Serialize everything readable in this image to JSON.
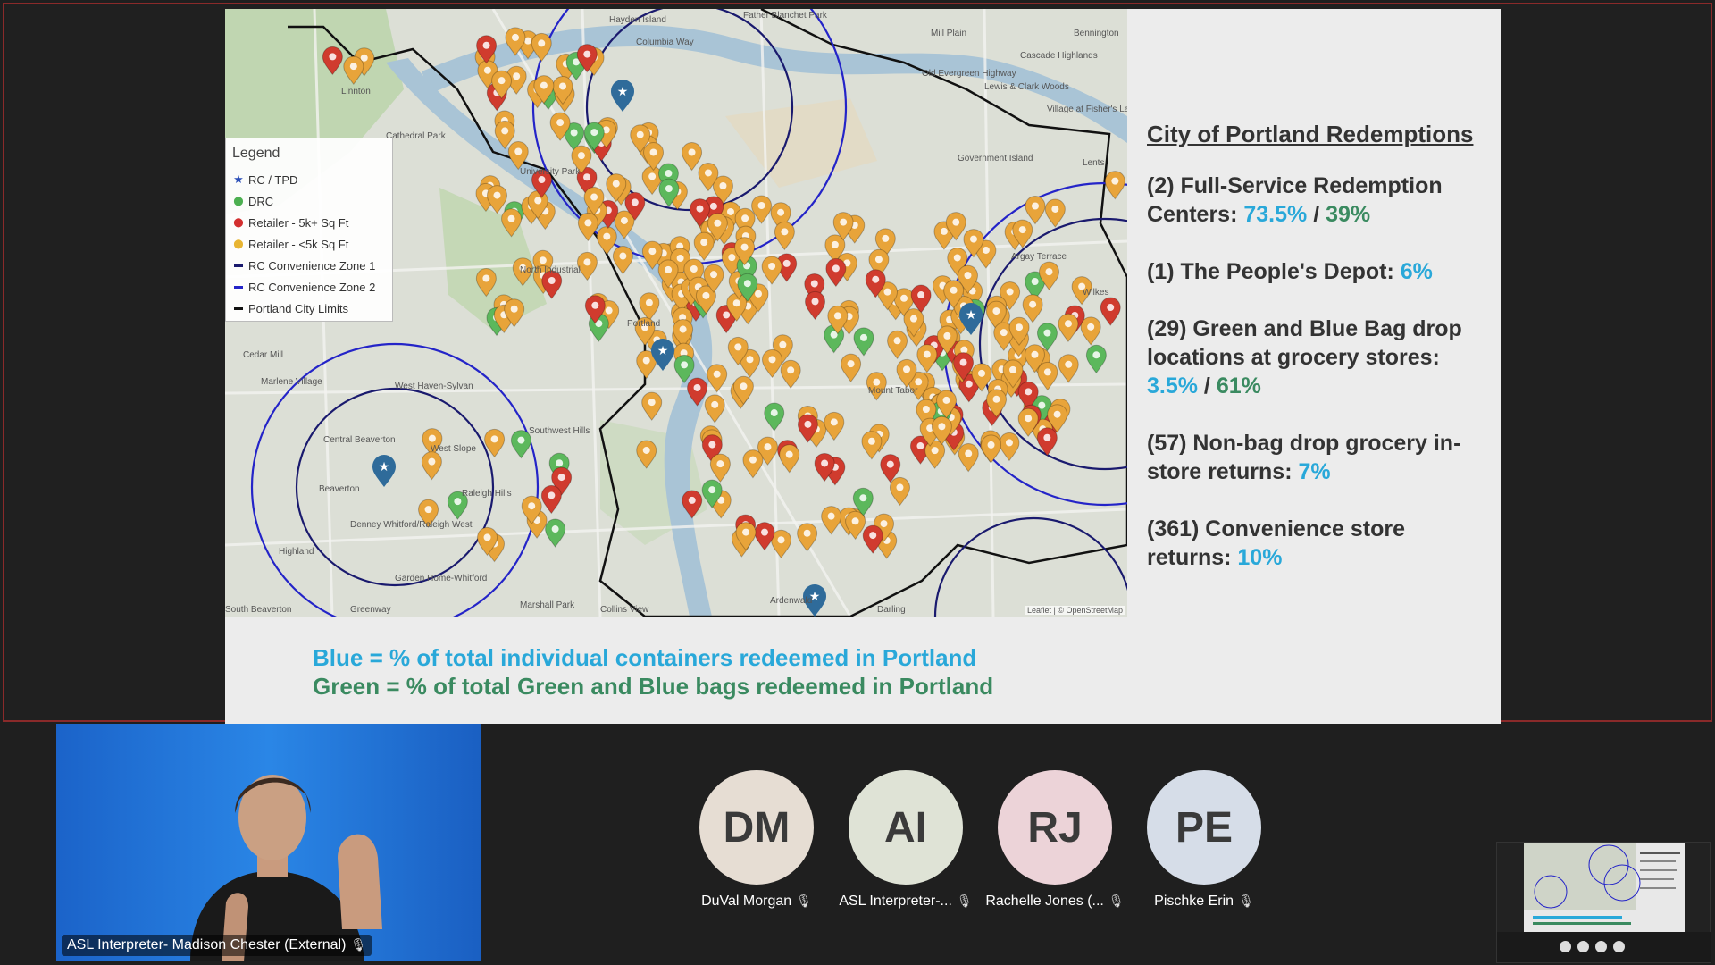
{
  "legend": {
    "title": "Legend",
    "items": [
      {
        "label": "RC / TPD",
        "color": "#2b4fb8",
        "symbol": "star"
      },
      {
        "label": "DRC",
        "color": "#4caf50",
        "symbol": "pin"
      },
      {
        "label": "Retailer - 5k+ Sq Ft",
        "color": "#d32f2f",
        "symbol": "pin"
      },
      {
        "label": "Retailer - <5k Sq Ft",
        "color": "#e8b533",
        "symbol": "pin"
      },
      {
        "label": "RC Convenience Zone 1",
        "color": "#1a1a6e",
        "symbol": "line"
      },
      {
        "label": "RC Convenience Zone 2",
        "color": "#2424c8",
        "symbol": "line"
      },
      {
        "label": "Portland City Limits",
        "color": "#111111",
        "symbol": "line"
      }
    ]
  },
  "map_labels": [
    "Father Blanchet Park",
    "Mill Plain",
    "Bennington",
    "Cascade Highlands",
    "Old Evergreen Highway",
    "Lewis & Clark Woods",
    "Village at Fisher's Landing",
    "Government Island",
    "Lents",
    "Hayden Island",
    "Columbia Way",
    "Cedar Mill",
    "Marlene Village",
    "West Haven-Sylvan",
    "Central Beaverton",
    "West Slope",
    "Beaverton",
    "Raleigh Hills",
    "Denney Whitford/Raleigh West",
    "Highland",
    "Garden Home-Whitford",
    "South Beaverton",
    "Greenway",
    "Portland",
    "Mount Tabor",
    "Southwest Hills",
    "Marshall Park",
    "Collins View",
    "Ardenwald",
    "Darling",
    "Argay Terrace",
    "Wilkes",
    "North Industrial",
    "University Park",
    "Cathedral Park",
    "Linnton"
  ],
  "map_attribution": "Leaflet | © OpenStreetMap",
  "stats": {
    "title": "City of Portland Redemptions",
    "items": [
      {
        "text": "(2) Full-Service Redemption Centers: ",
        "blue": "73.5%",
        "sep": " / ",
        "green": "39%"
      },
      {
        "text": "(1) The People's Depot: ",
        "blue": "6%"
      },
      {
        "text": "(29) Green and Blue Bag drop locations at grocery stores: ",
        "blue": "3.5%",
        "sep": " / ",
        "green": "61%"
      },
      {
        "text": "(57) Non-bag drop grocery in-store returns: ",
        "blue": "7%"
      },
      {
        "text": "(361) Convenience store returns: ",
        "blue": "10%"
      }
    ]
  },
  "notes": {
    "blue": "Blue = % of total individual containers redeemed in Portland",
    "green": "Green = % of total Green and Blue bags redeemed in Portland"
  },
  "self_video": {
    "label": "ASL Interpreter- Madison Chester (External)"
  },
  "participants": [
    {
      "initials": "DM",
      "name": "DuVal Morgan",
      "color": "#e6ddd3"
    },
    {
      "initials": "AI",
      "name": "ASL Interpreter-...",
      "color": "#dfe3d6"
    },
    {
      "initials": "RJ",
      "name": "Rachelle Jones (...",
      "color": "#ecd3d8"
    },
    {
      "initials": "PE",
      "name": "Pischke Erin",
      "color": "#d6dde8"
    }
  ],
  "colors": {
    "blue": "#29a8d9",
    "green": "#3a8a60"
  }
}
